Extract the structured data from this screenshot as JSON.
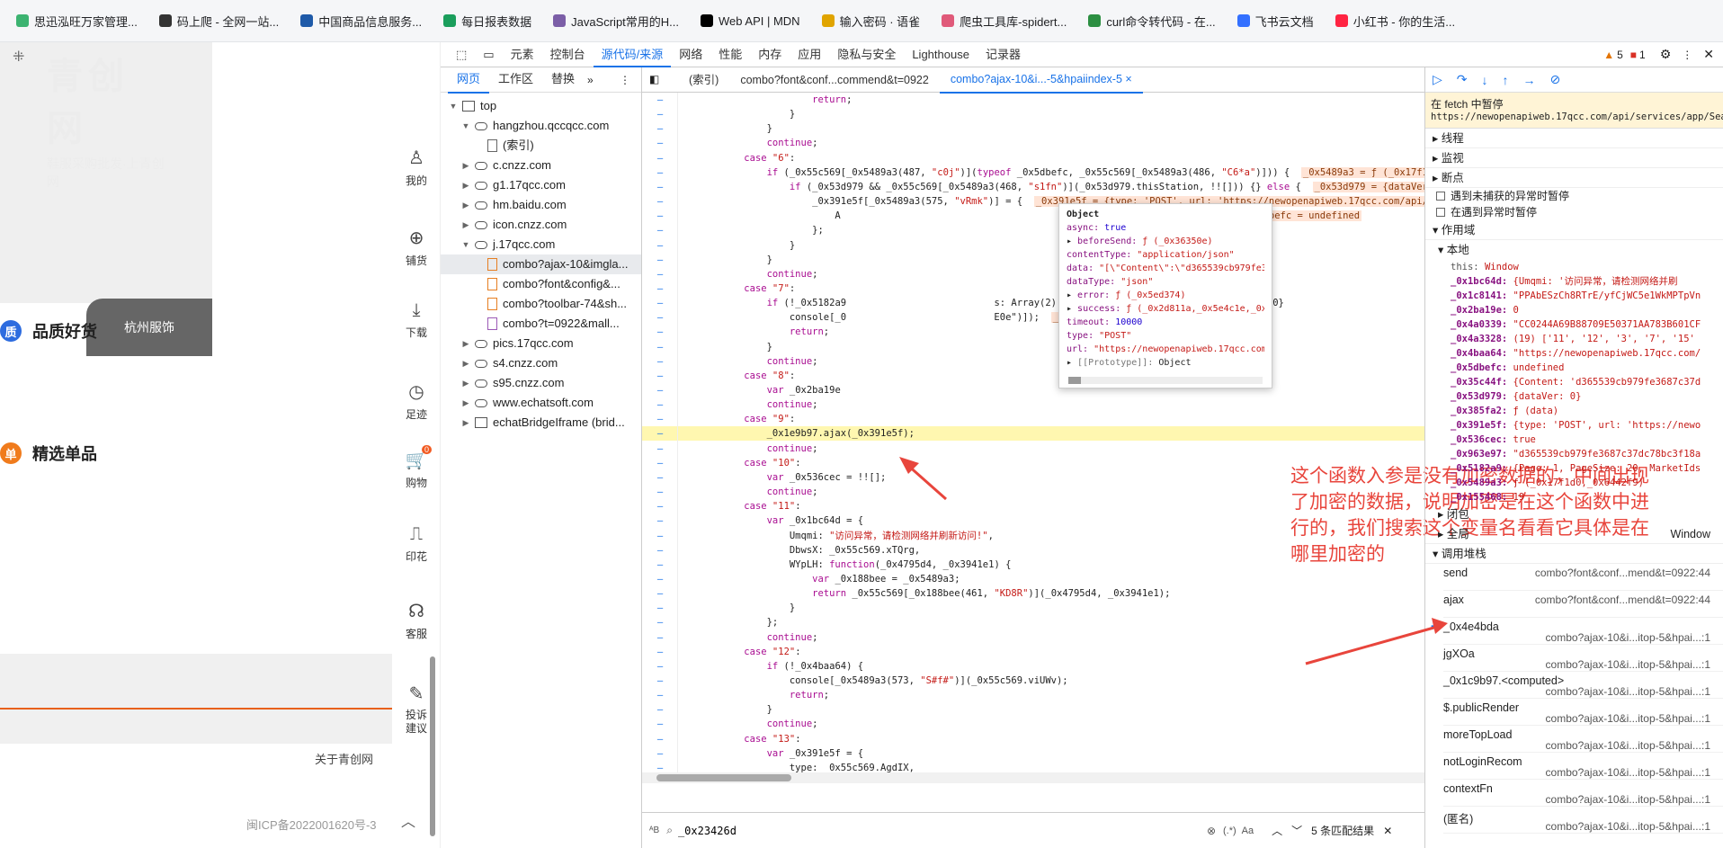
{
  "bookmarks": [
    {
      "label": "思迅泓旺万家管理...",
      "color": "#3cb371"
    },
    {
      "label": "码上爬 - 全网一站...",
      "color": "#333333"
    },
    {
      "label": "中国商品信息服务...",
      "color": "#1e5aa8"
    },
    {
      "label": "每日报表数据",
      "color": "#1a9e5c"
    },
    {
      "label": "JavaScript常用的H...",
      "color": "#7b5ea7"
    },
    {
      "label": "Web API | MDN",
      "color": "#000000"
    },
    {
      "label": "输入密码 · 语雀",
      "color": "#e0a400"
    },
    {
      "label": "爬虫工具库-spidert...",
      "color": "#e05a7a"
    },
    {
      "label": "curl命令转代码 - 在...",
      "color": "#2c8f42"
    },
    {
      "label": "飞书云文档",
      "color": "#3370ff"
    },
    {
      "label": "小红书 - 你的生活...",
      "color": "#ff2442"
    }
  ],
  "site": {
    "logo_big": "青创网",
    "logo_small": "鞋服采购批发·上青创网",
    "dark_tab": "杭州服饰",
    "feature1": "品质好货",
    "feature1_icon": "质",
    "feature2": "精选单品",
    "feature2_icon": "单",
    "footer_link": "关于青创网",
    "icp": "闽ICP备2022001620号-3"
  },
  "rail": [
    {
      "label": "我的",
      "icon": "♙"
    },
    {
      "label": "铺货",
      "icon": "⊕"
    },
    {
      "label": "下载",
      "icon": "⤓"
    },
    {
      "label": "足迹",
      "icon": "◷"
    },
    {
      "label": "购物",
      "icon": "🛒",
      "badge": "0"
    },
    {
      "label": "印花",
      "icon": "⎍"
    },
    {
      "label": "客服",
      "icon": "☊"
    },
    {
      "label": "投诉建议",
      "icon": "✎"
    }
  ],
  "devtools": {
    "tabs": [
      "元素",
      "控制台",
      "源代码/来源",
      "网络",
      "性能",
      "内存",
      "应用",
      "隐私与安全",
      "Lighthouse",
      "记录器"
    ],
    "active_tab": "源代码/来源",
    "warn_count": "5",
    "err_count": "1",
    "nav_tabs": [
      "网页",
      "工作区",
      "替换"
    ],
    "tree": [
      {
        "label": "top",
        "type": "frame",
        "depth": 0,
        "open": true
      },
      {
        "label": "hangzhou.qccqcc.com",
        "type": "cloud",
        "depth": 1,
        "open": true
      },
      {
        "label": "(索引)",
        "type": "file",
        "depth": 2
      },
      {
        "label": "c.cnzz.com",
        "type": "cloud",
        "depth": 1
      },
      {
        "label": "g1.17qcc.com",
        "type": "cloud",
        "depth": 1
      },
      {
        "label": "hm.baidu.com",
        "type": "cloud",
        "depth": 1
      },
      {
        "label": "icon.cnzz.com",
        "type": "cloud",
        "depth": 1
      },
      {
        "label": "j.17qcc.com",
        "type": "cloud",
        "depth": 1,
        "open": true
      },
      {
        "label": "combo?ajax-10&imgla...",
        "type": "file-o",
        "depth": 2,
        "sel": true
      },
      {
        "label": "combo?font&config&...",
        "type": "file-o",
        "depth": 2
      },
      {
        "label": "combo?toolbar-74&sh...",
        "type": "file-o",
        "depth": 2
      },
      {
        "label": "combo?t=0922&mall...",
        "type": "file-p",
        "depth": 2
      },
      {
        "label": "pics.17qcc.com",
        "type": "cloud",
        "depth": 1
      },
      {
        "label": "s4.cnzz.com",
        "type": "cloud",
        "depth": 1
      },
      {
        "label": "s95.cnzz.com",
        "type": "cloud",
        "depth": 1
      },
      {
        "label": "www.echatsoft.com",
        "type": "cloud",
        "depth": 1
      },
      {
        "label": "echatBridgeIframe (brid...",
        "type": "frame",
        "depth": 1
      }
    ],
    "editor_tabs": [
      "(索引)",
      "combo?font&conf...commend&t=0922",
      "combo?ajax-10&i...-5&hpaiindex-5"
    ],
    "search_value": "_0x23426d",
    "search_result": "5 条匹配结果",
    "search_aa": "Aa",
    "search_regex": "(.*)"
  },
  "code_lines": [
    {
      "t": "                return;"
    },
    {
      "t": "            }"
    },
    {
      "t": "        }"
    },
    {
      "t": "        continue;"
    },
    {
      "t": "    case \"6\":"
    },
    {
      "t": "        if (_0x55c569[_0x5489a3(487, \"c0j\")](typeof _0x5dbefc, _0x55c569[_0x5489a3(486, \"C6*a\")])) {",
      "i": "_0x5489a3 = ƒ (_0x17f1d"
    },
    {
      "t": "            if (_0x53d979 && _0x55c569[_0x5489a3(468, \"s1fn\")](_0x53d979.thisStation, !![])) {} else {",
      "i": "_0x53d979 = {dataVer: 0"
    },
    {
      "t": "                _0x391e5f[_0x5489a3(575, \"vRmk\")] = {",
      "i": "_0x391e5f = {type: 'POST', url: 'https://newopenapiweb.17qcc.com/api/se"
    },
    {
      "t": "                    A                                         _0x55c569.Lwzuk, _0x5dbefc)",
      "i": "_0x5dbefc = undefined"
    },
    {
      "t": "                };"
    },
    {
      "t": "            }"
    },
    {
      "t": "        }"
    },
    {
      "t": "        continue;"
    },
    {
      "t": "    case \"7\":"
    },
    {
      "t": "        if (!_0x5182a9                          s: Array(2), ProductOrderType: 0, IsGetVipPrice: 0}"
    },
    {
      "t": "            console[_0                          E0e\")]);",
      "i": "_0x5489a3 = ƒ (_0x17f1d0, _0x6442f9)"
    },
    {
      "t": "            return;"
    },
    {
      "t": "        }"
    },
    {
      "t": "        continue;"
    },
    {
      "t": "    case \"8\":"
    },
    {
      "t": "        var _0x2ba19e"
    },
    {
      "t": "        continue;"
    },
    {
      "t": "    case \"9\":"
    },
    {
      "t": "        _0x1e9b97.ajax(_0x391e5f);",
      "hl": true
    },
    {
      "t": "        continue;"
    },
    {
      "t": "    case \"10\":"
    },
    {
      "t": "        var _0x536cec = !![];"
    },
    {
      "t": "        continue;"
    },
    {
      "t": "    case \"11\":"
    },
    {
      "t": "        var _0x1bc64d = {"
    },
    {
      "t": "            Umqmi: \"访问异常，请检测网络并刷新访问!\","
    },
    {
      "t": "            DbwsX: _0x55c569.xTQrg,"
    },
    {
      "t": "            WYpLH: function(_0x4795d4, _0x3941e1) {"
    },
    {
      "t": "                var _0x188bee = _0x5489a3;"
    },
    {
      "t": "                return _0x55c569[_0x188bee(461, \"KD8R\")](_0x4795d4, _0x3941e1);"
    },
    {
      "t": "            }"
    },
    {
      "t": "        };"
    },
    {
      "t": "        continue;"
    },
    {
      "t": "    case \"12\":"
    },
    {
      "t": "        if (!_0x4baa64) {"
    },
    {
      "t": "            console[_0x5489a3(573, \"S#f#\")](_0x55c569.viUWv);"
    },
    {
      "t": "            return;"
    },
    {
      "t": "        }"
    },
    {
      "t": "        continue;"
    },
    {
      "t": "    case \"13\":"
    },
    {
      "t": "        var _0x391e5f = {"
    },
    {
      "t": "            type: _0x55c569.AgdIX,"
    }
  ],
  "popup": {
    "title": "Object",
    "rows": [
      {
        "k": "async",
        "v": "true",
        "c": "n"
      },
      {
        "k": "beforeSend",
        "v": "ƒ (_0x36350e)",
        "c": "v",
        "exp": true
      },
      {
        "k": "contentType",
        "v": "\"application/json\"",
        "c": "v"
      },
      {
        "k": "data",
        "v": "\"[\\\"Content\\\":\\\"d365539cb979fe3687c37d",
        "c": "v"
      },
      {
        "k": "dataType",
        "v": "\"json\"",
        "c": "v"
      },
      {
        "k": "error",
        "v": "ƒ (_0x5ed374)",
        "c": "v",
        "exp": true
      },
      {
        "k": "success",
        "v": "ƒ (_0x2d811a,_0x5e4c1e,_0x482987)",
        "c": "v",
        "exp": true
      },
      {
        "k": "timeout",
        "v": "10000",
        "c": "n"
      },
      {
        "k": "type",
        "v": "\"POST\"",
        "c": "v"
      },
      {
        "k": "url",
        "v": "\"https://newopenapiweb.17qcc.com/api/se",
        "c": "v"
      },
      {
        "k": "[[Prototype]]",
        "v": "Object",
        "c": "x",
        "exp": true
      }
    ]
  },
  "annotation": "这个函数入参是没有加密数据的，中间出现了加密的数据，说明加密是在这个函数中进行的，我们搜索这个变量名看看它具体是在哪里加密的",
  "debugger": {
    "paused_title": "在 fetch 中暂停",
    "paused_url": "https://newopenapiweb.17qcc.com/api/services/app/SearchFactor",
    "sections": [
      "线程",
      "监视",
      "断点"
    ],
    "checks": [
      "遇到未捕获的异常时暂停",
      "在遇到异常时暂停"
    ],
    "scope_title": "作用域",
    "local_title": "本地",
    "scope": [
      {
        "k": "this",
        "v": "Window"
      },
      {
        "k": "_0x1bc64d",
        "v": "{Umqmi: '访问异常，请检测网络并刷"
      },
      {
        "k": "_0x1c8141",
        "v": "\"PPAbESzCh8RTrE/yfCjWC5e1WkMPTpVn"
      },
      {
        "k": "_0x2ba19e",
        "v": "0"
      },
      {
        "k": "_0x4a0339",
        "v": "\"CC0244A69B88709E50371AA783B601CF"
      },
      {
        "k": "_0x4a3328",
        "v": "(19) ['11', '12', '3', '7', '15'"
      },
      {
        "k": "_0x4baa64",
        "v": "\"https://newopenapiweb.17qcc.com/"
      },
      {
        "k": "_0x5dbefc",
        "v": "undefined"
      },
      {
        "k": "_0x35c44f",
        "v": "{Content: 'd365539cb979fe3687c37d"
      },
      {
        "k": "_0x53d979",
        "v": "{dataVer: 0}"
      },
      {
        "k": "_0x385fa2",
        "v": "ƒ (data)"
      },
      {
        "k": "_0x391e5f",
        "v": "{type: 'POST', url: 'https://newo"
      },
      {
        "k": "_0x536cec",
        "v": "true"
      },
      {
        "k": "_0x963e97",
        "v": "\"d365539cb979fe3687c37dc78bc3f18a"
      },
      {
        "k": "_0x5182a9",
        "v": "{Page: 1, PageSize: 20, MarketIds"
      },
      {
        "k": "_0x5489a3",
        "v": "ƒ (_0x17f1d0,_0x6442f9)"
      },
      {
        "k": "_0x155468",
        "v": "19"
      }
    ],
    "closure": "闭包",
    "global": "全局",
    "global_val": "Window",
    "stack_title": "调用堆栈",
    "stack": [
      {
        "fn": "send",
        "loc": "combo?font&conf...mend&t=0922:44"
      },
      {
        "fn": "ajax",
        "loc": "combo?font&conf...mend&t=0922:44"
      },
      {
        "fn": "_0x4e4bda",
        "loc": "combo?ajax-10&i...itop-5&hpai...:1",
        "cur": true
      },
      {
        "fn": "jgXOa",
        "loc": "combo?ajax-10&i...itop-5&hpai...:1"
      },
      {
        "fn": "_0x1c9b97.<computed>",
        "loc": "combo?ajax-10&i...itop-5&hpai...:1"
      },
      {
        "fn": "$.publicRender",
        "loc": "combo?ajax-10&i...itop-5&hpai...:1"
      },
      {
        "fn": "moreTopLoad",
        "loc": "combo?ajax-10&i...itop-5&hpai...:1"
      },
      {
        "fn": "notLoginRecom",
        "loc": "combo?ajax-10&i...itop-5&hpai...:1"
      },
      {
        "fn": "contextFn",
        "loc": "combo?ajax-10&i...itop-5&hpai...:1"
      },
      {
        "fn": "(匿名)",
        "loc": "combo?ajax-10&i...itop-5&hpai...:1"
      }
    ]
  },
  "colors": {
    "accent": "#1a73e8",
    "annotation": "#e8453c",
    "highlight": "#fff7b0"
  }
}
